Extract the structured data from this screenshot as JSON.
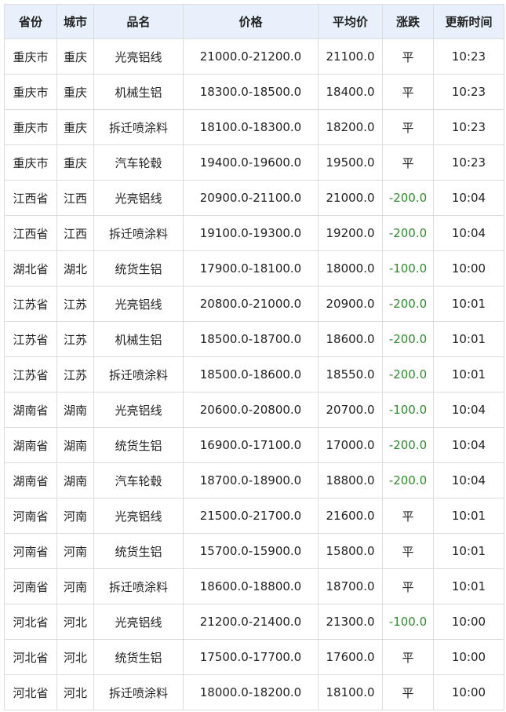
{
  "colors": {
    "header_bg": "#e8f1fb",
    "border": "#dcdcdc",
    "down_text": "#2f8a2f",
    "text": "#222222"
  },
  "table": {
    "headers": [
      "省份",
      "城市",
      "品名",
      "价格",
      "平均价",
      "涨跌",
      "更新时间"
    ],
    "rows": [
      [
        "重庆市",
        "重庆",
        "光亮铝线",
        "21000.0-21200.0",
        "21100.0",
        "平",
        "10:23"
      ],
      [
        "重庆市",
        "重庆",
        "机械生铝",
        "18300.0-18500.0",
        "18400.0",
        "平",
        "10:23"
      ],
      [
        "重庆市",
        "重庆",
        "拆迁喷涂料",
        "18100.0-18300.0",
        "18200.0",
        "平",
        "10:23"
      ],
      [
        "重庆市",
        "重庆",
        "汽车轮毂",
        "19400.0-19600.0",
        "19500.0",
        "平",
        "10:23"
      ],
      [
        "江西省",
        "江西",
        "光亮铝线",
        "20900.0-21100.0",
        "21000.0",
        "-200.0",
        "10:04"
      ],
      [
        "江西省",
        "江西",
        "拆迁喷涂料",
        "19100.0-19300.0",
        "19200.0",
        "-200.0",
        "10:04"
      ],
      [
        "湖北省",
        "湖北",
        "统货生铝",
        "17900.0-18100.0",
        "18000.0",
        "-100.0",
        "10:00"
      ],
      [
        "江苏省",
        "江苏",
        "光亮铝线",
        "20800.0-21000.0",
        "20900.0",
        "-200.0",
        "10:01"
      ],
      [
        "江苏省",
        "江苏",
        "机械生铝",
        "18500.0-18700.0",
        "18600.0",
        "-200.0",
        "10:01"
      ],
      [
        "江苏省",
        "江苏",
        "拆迁喷涂料",
        "18500.0-18600.0",
        "18550.0",
        "-200.0",
        "10:01"
      ],
      [
        "湖南省",
        "湖南",
        "光亮铝线",
        "20600.0-20800.0",
        "20700.0",
        "-100.0",
        "10:04"
      ],
      [
        "湖南省",
        "湖南",
        "统货生铝",
        "16900.0-17100.0",
        "17000.0",
        "-200.0",
        "10:04"
      ],
      [
        "湖南省",
        "湖南",
        "汽车轮毂",
        "18700.0-18900.0",
        "18800.0",
        "-200.0",
        "10:04"
      ],
      [
        "河南省",
        "河南",
        "光亮铝线",
        "21500.0-21700.0",
        "21600.0",
        "平",
        "10:01"
      ],
      [
        "河南省",
        "河南",
        "统货生铝",
        "15700.0-15900.0",
        "15800.0",
        "平",
        "10:01"
      ],
      [
        "河南省",
        "河南",
        "拆迁喷涂料",
        "18600.0-18800.0",
        "18700.0",
        "平",
        "10:01"
      ],
      [
        "河北省",
        "河北",
        "光亮铝线",
        "21200.0-21400.0",
        "21300.0",
        "-100.0",
        "10:00"
      ],
      [
        "河北省",
        "河北",
        "统货生铝",
        "17500.0-17700.0",
        "17600.0",
        "平",
        "10:00"
      ],
      [
        "河北省",
        "河北",
        "拆迁喷涂料",
        "18000.0-18200.0",
        "18100.0",
        "平",
        "10:00"
      ]
    ]
  }
}
